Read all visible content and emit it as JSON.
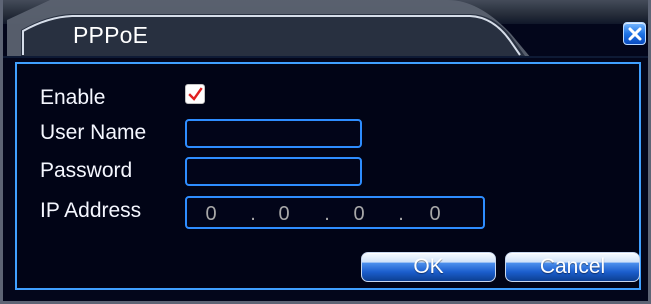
{
  "dialog": {
    "title": "PPPoE",
    "close_icon": "close-icon",
    "colors": {
      "background": "#03061b",
      "frame": "#40a0ff",
      "input_border": "#2e8dff",
      "accent": "#1d72e5",
      "text": "#f5f7ff"
    }
  },
  "form": {
    "enable_label": "Enable",
    "enable_checked": true,
    "check_icon": "check-icon",
    "username_label": "User Name",
    "username_value": "",
    "password_label": "Password",
    "password_value": "",
    "ip_label": "IP Address",
    "ip_octets": [
      "0",
      "0",
      "0",
      "0"
    ],
    "ip_separators": [
      ".",
      ".",
      "."
    ]
  },
  "actions": {
    "ok_label": "OK",
    "cancel_label": "Cancel"
  }
}
